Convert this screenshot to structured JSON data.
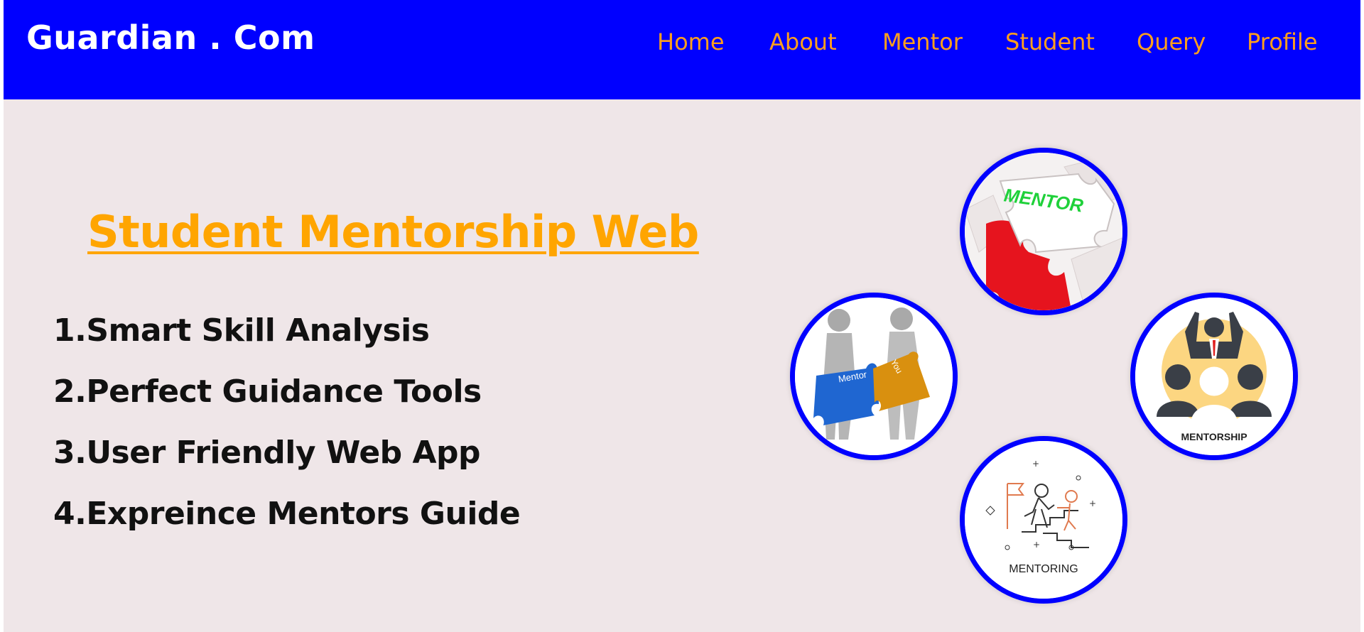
{
  "header": {
    "brand": "Guardian . Com",
    "nav": [
      "Home",
      "About",
      "Mentor",
      "Student",
      "Query",
      "Profile"
    ]
  },
  "hero": {
    "title": "Student Mentorship Web",
    "features": [
      "1.Smart Skill Analysis",
      "2.Perfect Guidance Tools",
      "3.User Friendly Web App",
      "4.Expreince Mentors Guide"
    ]
  },
  "images": {
    "mentor_puzzle": {
      "label": "MENTOR",
      "icon": "puzzle-mentor-icon"
    },
    "mentor_you": {
      "labels": [
        "Mentor",
        "You"
      ],
      "icon": "people-puzzle-icon"
    },
    "mentorship": {
      "label": "MENTORSHIP",
      "icon": "mentorship-people-icon"
    },
    "mentoring": {
      "label": "MENTORING",
      "icon": "mentoring-stairs-icon"
    }
  },
  "colors": {
    "navbar": "#0000ff",
    "nav_link": "#ff9f1c",
    "title": "#ffa500",
    "background": "#efe6e8",
    "circle_border": "#0000ff"
  }
}
